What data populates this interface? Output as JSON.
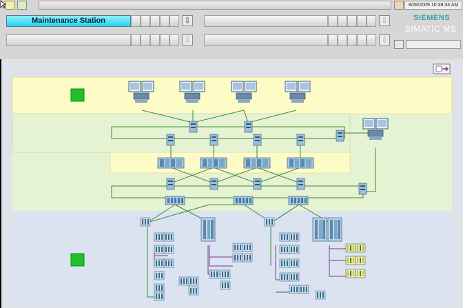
{
  "header": {
    "active_tab": "Maintenance Station",
    "datetime": "9/28/2009 10:39:34 AM",
    "brand": "SIEMENS",
    "product": "SIMATIC MS"
  },
  "colors": {
    "area_yellow": "#fdfbc6",
    "area_green": "#e6f3d2",
    "area_blue": "#dbe3f0",
    "status_green": "#22c02a",
    "bus_green": "#3b8a3b",
    "bus_purple": "#7a3a8a"
  },
  "icons": {
    "top_left": [
      "cursor-icon",
      "folder-icon",
      "pen-icon"
    ],
    "datetime_btn": "calendar-icon",
    "export_btn": "export-arrow-icon"
  }
}
